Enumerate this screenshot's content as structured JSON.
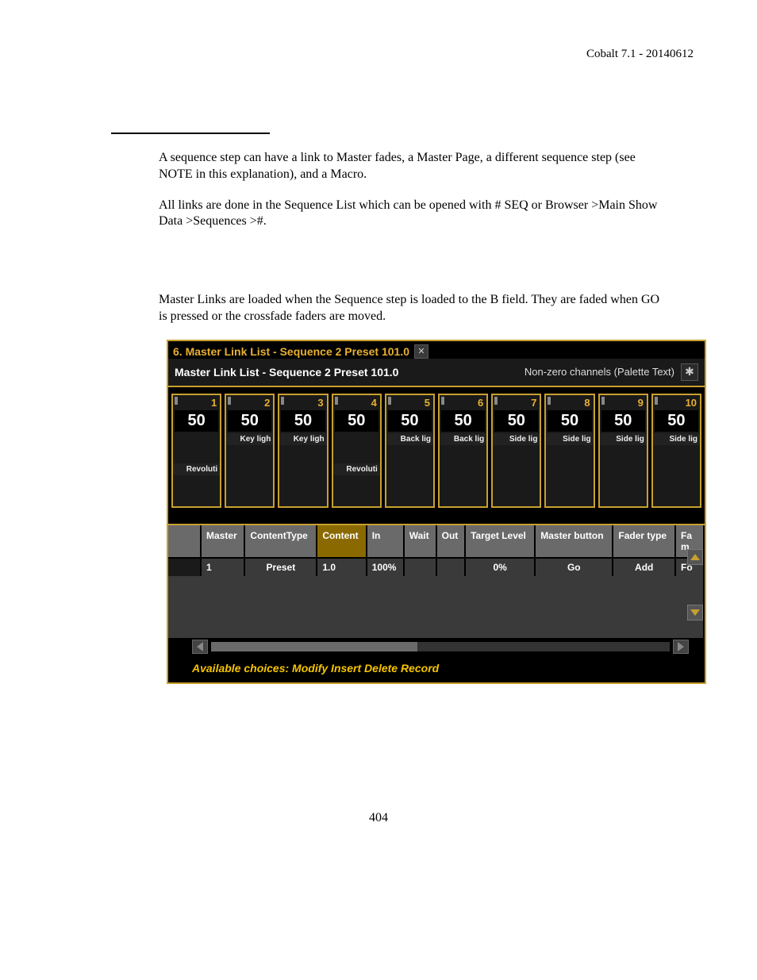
{
  "header": {
    "right": "Cobalt 7.1 - 20140612"
  },
  "paragraphs": {
    "p1": "A sequence step can have a  link to Master fades, a Master Page, a different sequence step (see NOTE in this explanation), and a Macro.",
    "p2": "All links are done in the Sequence List which can be opened with # SEQ or Browser >Main Show Data >Sequences >#.",
    "p3": "Master Links are loaded when the Sequence step is loaded to the B field. They are faded when GO is pressed or the crossfade faders are moved."
  },
  "window": {
    "tab_title": "6. Master Link List - Sequence 2 Preset 101.0",
    "sub_title": "Master Link List - Sequence 2 Preset 101.0",
    "sub_right": "Non-zero channels (Palette Text)"
  },
  "channels": [
    {
      "num": "1",
      "val": "50",
      "label_top": "",
      "label_bottom": "Revoluti"
    },
    {
      "num": "2",
      "val": "50",
      "label_top": "Key ligh",
      "label_bottom": ""
    },
    {
      "num": "3",
      "val": "50",
      "label_top": "Key ligh",
      "label_bottom": ""
    },
    {
      "num": "4",
      "val": "50",
      "label_top": "",
      "label_bottom": "Revoluti"
    },
    {
      "num": "5",
      "val": "50",
      "label_top": "Back lig",
      "label_bottom": ""
    },
    {
      "num": "6",
      "val": "50",
      "label_top": "Back lig",
      "label_bottom": ""
    },
    {
      "num": "7",
      "val": "50",
      "label_top": "Side lig",
      "label_bottom": ""
    },
    {
      "num": "8",
      "val": "50",
      "label_top": "Side lig",
      "label_bottom": ""
    },
    {
      "num": "9",
      "val": "50",
      "label_top": "Side lig",
      "label_bottom": ""
    },
    {
      "num": "10",
      "val": "50",
      "label_top": "Side lig",
      "label_bottom": ""
    }
  ],
  "table": {
    "headers": [
      "",
      "Master",
      "ContentType",
      "Content",
      "In",
      "Wait",
      "Out",
      "Target Level",
      "Master button",
      "Fader type",
      "Fa m"
    ],
    "row": [
      "",
      "1",
      "Preset",
      "1.0",
      "100%",
      "",
      "",
      "0%",
      "Go",
      "Add",
      "Fo"
    ]
  },
  "footer_line": "Available choices: Modify Insert Delete Record",
  "page_number": "404"
}
